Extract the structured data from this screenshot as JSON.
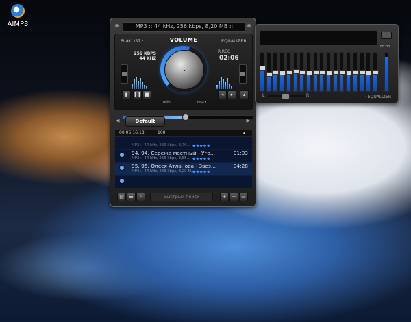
{
  "desktop": {
    "icon_label": "AIMP3"
  },
  "player": {
    "title_text": "MP3 :: 44 kHz, 256 kbps, 8,20 MB ::",
    "playlist_label": "PLAYLIST ·",
    "volume_label": "VOLUME",
    "equalizer_label": "· EQUALIZER",
    "bitrate": "256 KBPS",
    "samplerate": "44 KHZ",
    "rec_label": "R.REC",
    "time": "02:06",
    "volume_min": "min",
    "volume_max": "max",
    "seek_progress": 0.48
  },
  "playlist": {
    "tab_label": "Default",
    "stats_time": "00:06:16:18",
    "stats_count": "100",
    "search_placeholder": "Быстрый поиск",
    "items": [
      {
        "title": "",
        "meta": "MP3 :: 44 kHz, 256 kbps, 3,76...",
        "stars": "★★★★★",
        "duration": "",
        "dim": true
      },
      {
        "title": "94. 94. Сережа местный - Уго...",
        "meta": "MP3 :: 44 kHz, 256 kbps, 3,85...",
        "stars": "★★★★★",
        "duration": "01:03",
        "dim": false
      },
      {
        "title": "95. 95. Олеся Атланова - Звез...",
        "meta": "MP3 :: 44 kHz, 256 kbps, 8,20 M...",
        "stars": "★★★★★",
        "duration": "04:28",
        "dim": false,
        "active": true
      },
      {
        "title": "",
        "meta": "",
        "stars": "",
        "duration": "",
        "dim": true
      }
    ]
  },
  "equalizer": {
    "off_on": "off on",
    "label": "· EQUALIZER",
    "bal_left": "L",
    "bal_right": "R",
    "bands": [
      0.6,
      0.45,
      0.5,
      0.48,
      0.5,
      0.52,
      0.5,
      0.48,
      0.5,
      0.5,
      0.48,
      0.5,
      0.5,
      0.48,
      0.5,
      0.5,
      0.48,
      0.5
    ]
  }
}
